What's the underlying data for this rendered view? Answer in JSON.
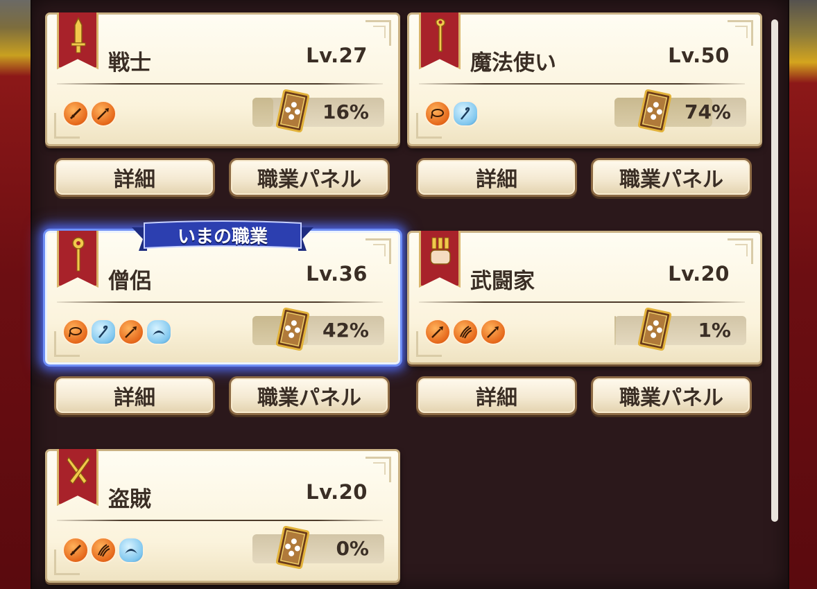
{
  "current_job_label": "いまの職業",
  "buttons": {
    "detail": "詳細",
    "job_panel": "職業パネル"
  },
  "jobs": [
    {
      "name": "戦士",
      "level": "Lv.27",
      "progress": "16%",
      "progress_value": 0.16,
      "emblem": "sword-icon",
      "weapons": [
        {
          "icon": "sword-weapon-icon",
          "color": "orange"
        },
        {
          "icon": "spear-weapon-icon",
          "color": "orange"
        }
      ]
    },
    {
      "name": "魔法使い",
      "level": "Lv.50",
      "progress": "74%",
      "progress_value": 0.74,
      "emblem": "wand-icon",
      "weapons": [
        {
          "icon": "whip-weapon-icon",
          "color": "orange"
        },
        {
          "icon": "staff-weapon-icon",
          "color": "blue"
        }
      ]
    },
    {
      "name": "僧侶",
      "level": "Lv.36",
      "progress": "42%",
      "progress_value": 0.42,
      "emblem": "scepter-icon",
      "current": true,
      "weapons": [
        {
          "icon": "whip-weapon-icon",
          "color": "orange"
        },
        {
          "icon": "staff-weapon-icon",
          "color": "blue"
        },
        {
          "icon": "spear-weapon-icon",
          "color": "orange"
        },
        {
          "icon": "boomerang-weapon-icon",
          "color": "blue"
        }
      ]
    },
    {
      "name": "武闘家",
      "level": "Lv.20",
      "progress": "1%",
      "progress_value": 0.01,
      "emblem": "fist-icon",
      "weapons": [
        {
          "icon": "spear-weapon-icon",
          "color": "orange"
        },
        {
          "icon": "claw-weapon-icon",
          "color": "orange"
        },
        {
          "icon": "spear-weapon-icon",
          "color": "orange"
        }
      ]
    },
    {
      "name": "盗賊",
      "level": "Lv.20",
      "progress": "0%",
      "progress_value": 0.0,
      "emblem": "daggers-icon",
      "weapons": [
        {
          "icon": "sword-weapon-icon",
          "color": "orange"
        },
        {
          "icon": "claw-weapon-icon",
          "color": "orange"
        },
        {
          "icon": "boomerang-weapon-icon",
          "color": "blue"
        }
      ]
    }
  ],
  "colors": {
    "banner": "#a8222a",
    "card": "#fbf3dc",
    "highlight": "#4a62e0",
    "ribbon": "#2c3fb0"
  }
}
